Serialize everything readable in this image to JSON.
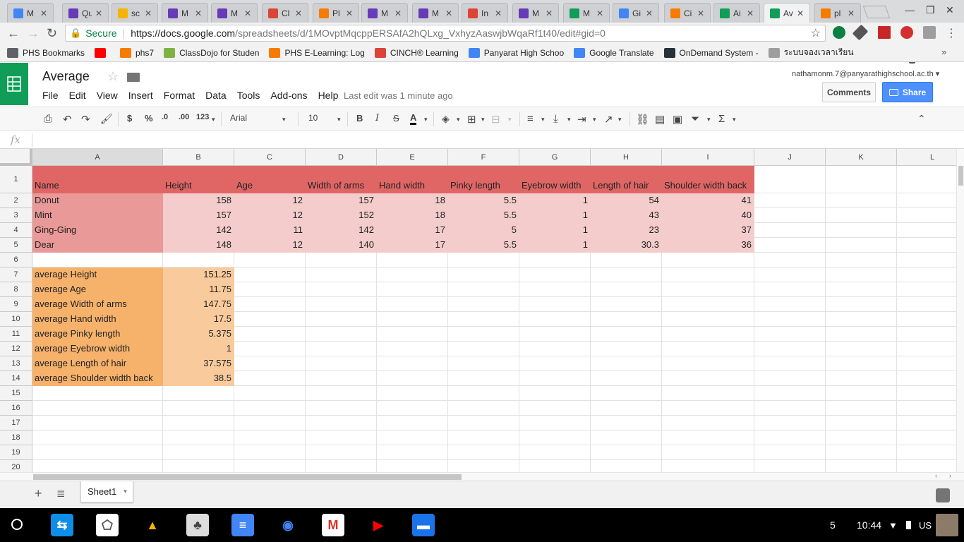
{
  "browser": {
    "tabs": [
      {
        "title": "M",
        "color": "#4285f4"
      },
      {
        "title": "Qu",
        "color": "#673ab7"
      },
      {
        "title": "sc",
        "color": "#f4b400"
      },
      {
        "title": "M",
        "color": "#673ab7"
      },
      {
        "title": "M",
        "color": "#673ab7"
      },
      {
        "title": "Cl",
        "color": "#db4437"
      },
      {
        "title": "Pl",
        "color": "#f57c00"
      },
      {
        "title": "M",
        "color": "#673ab7"
      },
      {
        "title": "M",
        "color": "#673ab7"
      },
      {
        "title": "In",
        "color": "#db4437"
      },
      {
        "title": "M",
        "color": "#673ab7"
      },
      {
        "title": "M",
        "color": "#0f9d58"
      },
      {
        "title": "Gi",
        "color": "#4285f4"
      },
      {
        "title": "Ci",
        "color": "#f57c00"
      },
      {
        "title": "Ai",
        "color": "#0f9d58"
      },
      {
        "title": "Av",
        "color": "#0f9d58",
        "active": true
      },
      {
        "title": "pl",
        "color": "#f57c00"
      }
    ],
    "secure_label": "Secure",
    "url_host": "https://docs.google.com",
    "url_rest": "/spreadsheets/d/1MOvptMqcppERSAfA2hQLxg_VxhyzAaswjbWqaRf1t40/edit#gid=0",
    "extension_badge": "1",
    "bookmarks": [
      {
        "label": "PHS Bookmarks",
        "color": "#5f6368"
      },
      {
        "label": "",
        "color": "#ff0000"
      },
      {
        "label": "phs7",
        "color": "#f57c00"
      },
      {
        "label": "ClassDojo for Studen",
        "color": "#7cb342"
      },
      {
        "label": "PHS E-Learning: Log",
        "color": "#f57c00"
      },
      {
        "label": "CINCH® Learning",
        "color": "#db4437"
      },
      {
        "label": "Panyarat High Schoo",
        "color": "#4285f4"
      },
      {
        "label": "Google Translate",
        "color": "#4285f4"
      },
      {
        "label": "OnDemand System -",
        "color": "#263238"
      },
      {
        "label": "ระบบจองเวลาเรียน",
        "color": "#9e9e9e"
      }
    ]
  },
  "doc": {
    "title": "Average",
    "menu": [
      "File",
      "Edit",
      "View",
      "Insert",
      "Format",
      "Data",
      "Tools",
      "Add-ons",
      "Help"
    ],
    "last_edit": "Last edit was 1 minute ago",
    "account": "nathamonm.7@panyarathighschool.ac.th",
    "comments_label": "Comments",
    "share_label": "Share"
  },
  "toolbar": {
    "currency": "$",
    "percent": "%",
    "dec_less": ".0",
    "dec_more": ".00",
    "more_formats": "123",
    "font": "Arial",
    "size": "10",
    "bold": "B",
    "italic": "I",
    "strike": "S",
    "textcolor": "A",
    "sum": "Σ"
  },
  "formula_bar": {
    "fx": "fx",
    "value": ""
  },
  "sheet": {
    "columns": [
      "A",
      "B",
      "C",
      "D",
      "E",
      "F",
      "G",
      "H",
      "I",
      "J",
      "K",
      "L"
    ],
    "row_numbers": [
      "1",
      "2",
      "3",
      "4",
      "5",
      "6",
      "7",
      "8",
      "9",
      "10",
      "11",
      "12",
      "13",
      "14",
      "15",
      "16",
      "17",
      "18",
      "19",
      "20"
    ],
    "header_row": [
      "Name",
      "Height",
      "Age",
      "Width of arms",
      "Hand width",
      "Pinky length",
      "Eyebrow width",
      "Length of hair",
      "Shoulder width back"
    ],
    "data_rows": [
      [
        "Donut",
        "158",
        "12",
        "157",
        "18",
        "5.5",
        "1",
        "54",
        "41"
      ],
      [
        "Mint",
        "157",
        "12",
        "152",
        "18",
        "5.5",
        "1",
        "43",
        "40"
      ],
      [
        "Ging-Ging",
        "142",
        "11",
        "142",
        "17",
        "5",
        "1",
        "23",
        "37"
      ],
      [
        "Dear",
        "148",
        "12",
        "140",
        "17",
        "5.5",
        "1",
        "30.3",
        "36"
      ]
    ],
    "averages": [
      [
        "average Height",
        "151.25"
      ],
      [
        "average Age",
        "11.75"
      ],
      [
        "average Width of arms",
        "147.75"
      ],
      [
        "average Hand width",
        "17.5"
      ],
      [
        "average Pinky length",
        "5.375"
      ],
      [
        "average Eyebrow width",
        "1"
      ],
      [
        "average Length of hair",
        "37.575"
      ],
      [
        "average Shoulder width back",
        "38.5"
      ]
    ],
    "colors": {
      "header_fill": "#e06666",
      "name_fill": "#ea9999",
      "data_fill": "#f4cccc",
      "avg_label_fill": "#f6b26b",
      "avg_value_fill": "#f9cb9c"
    }
  },
  "sheet_tabs": {
    "active": "Sheet1"
  },
  "shelf": {
    "apps": [
      {
        "name": "teamviewer",
        "color": "#0e8ee9"
      },
      {
        "name": "geogebra",
        "color": "#ffffff"
      },
      {
        "name": "drive",
        "color": "#000000"
      },
      {
        "name": "tree-app",
        "color": "#dddddd"
      },
      {
        "name": "docs",
        "color": "#4285f4"
      },
      {
        "name": "chrome",
        "color": "#000000"
      },
      {
        "name": "gmail",
        "color": "#ffffff"
      },
      {
        "name": "youtube",
        "color": "#000000"
      },
      {
        "name": "files",
        "color": "#1a73e8"
      }
    ],
    "notifications": "5",
    "time": "10:44",
    "locale": "US"
  }
}
